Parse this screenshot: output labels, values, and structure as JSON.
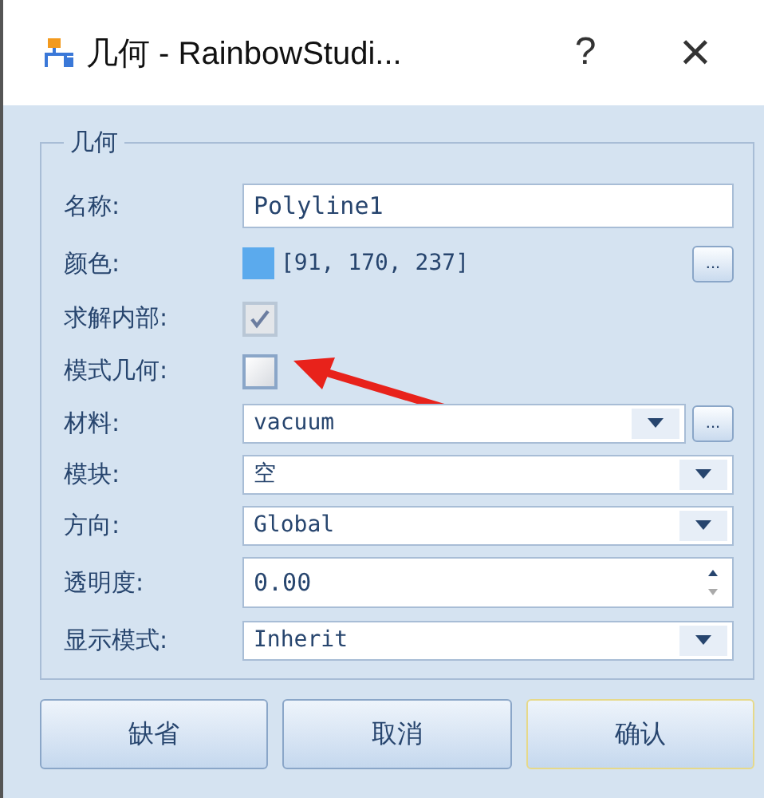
{
  "window": {
    "title": "几何 - RainbowStudi...",
    "help": "?",
    "close": "×"
  },
  "group": {
    "title": "几何"
  },
  "fields": [
    {
      "kind": "text",
      "label": "名称:",
      "value": "Polyline1"
    },
    {
      "kind": "color",
      "label": "颜色:",
      "value": "[91, 170, 237]",
      "color": "#5baaed",
      "button": "..."
    },
    {
      "kind": "checkbox",
      "label": "求解内部:",
      "checked": true,
      "disabled": true
    },
    {
      "kind": "checkbox",
      "label": "模式几何:",
      "checked": false,
      "disabled": false,
      "annotated": true
    },
    {
      "kind": "combo",
      "label": "材料:",
      "value": "vacuum",
      "button": "..."
    },
    {
      "kind": "combo",
      "label": "模块:",
      "value": "空"
    },
    {
      "kind": "combo",
      "label": "方向:",
      "value": "Global"
    },
    {
      "kind": "spin",
      "label": "透明度:",
      "value": "0.00"
    },
    {
      "kind": "combo",
      "label": "显示模式:",
      "value": "Inherit"
    }
  ],
  "buttons": [
    {
      "label": "缺省",
      "default": false
    },
    {
      "label": "取消",
      "default": false
    },
    {
      "label": "确认",
      "default": true
    }
  ]
}
